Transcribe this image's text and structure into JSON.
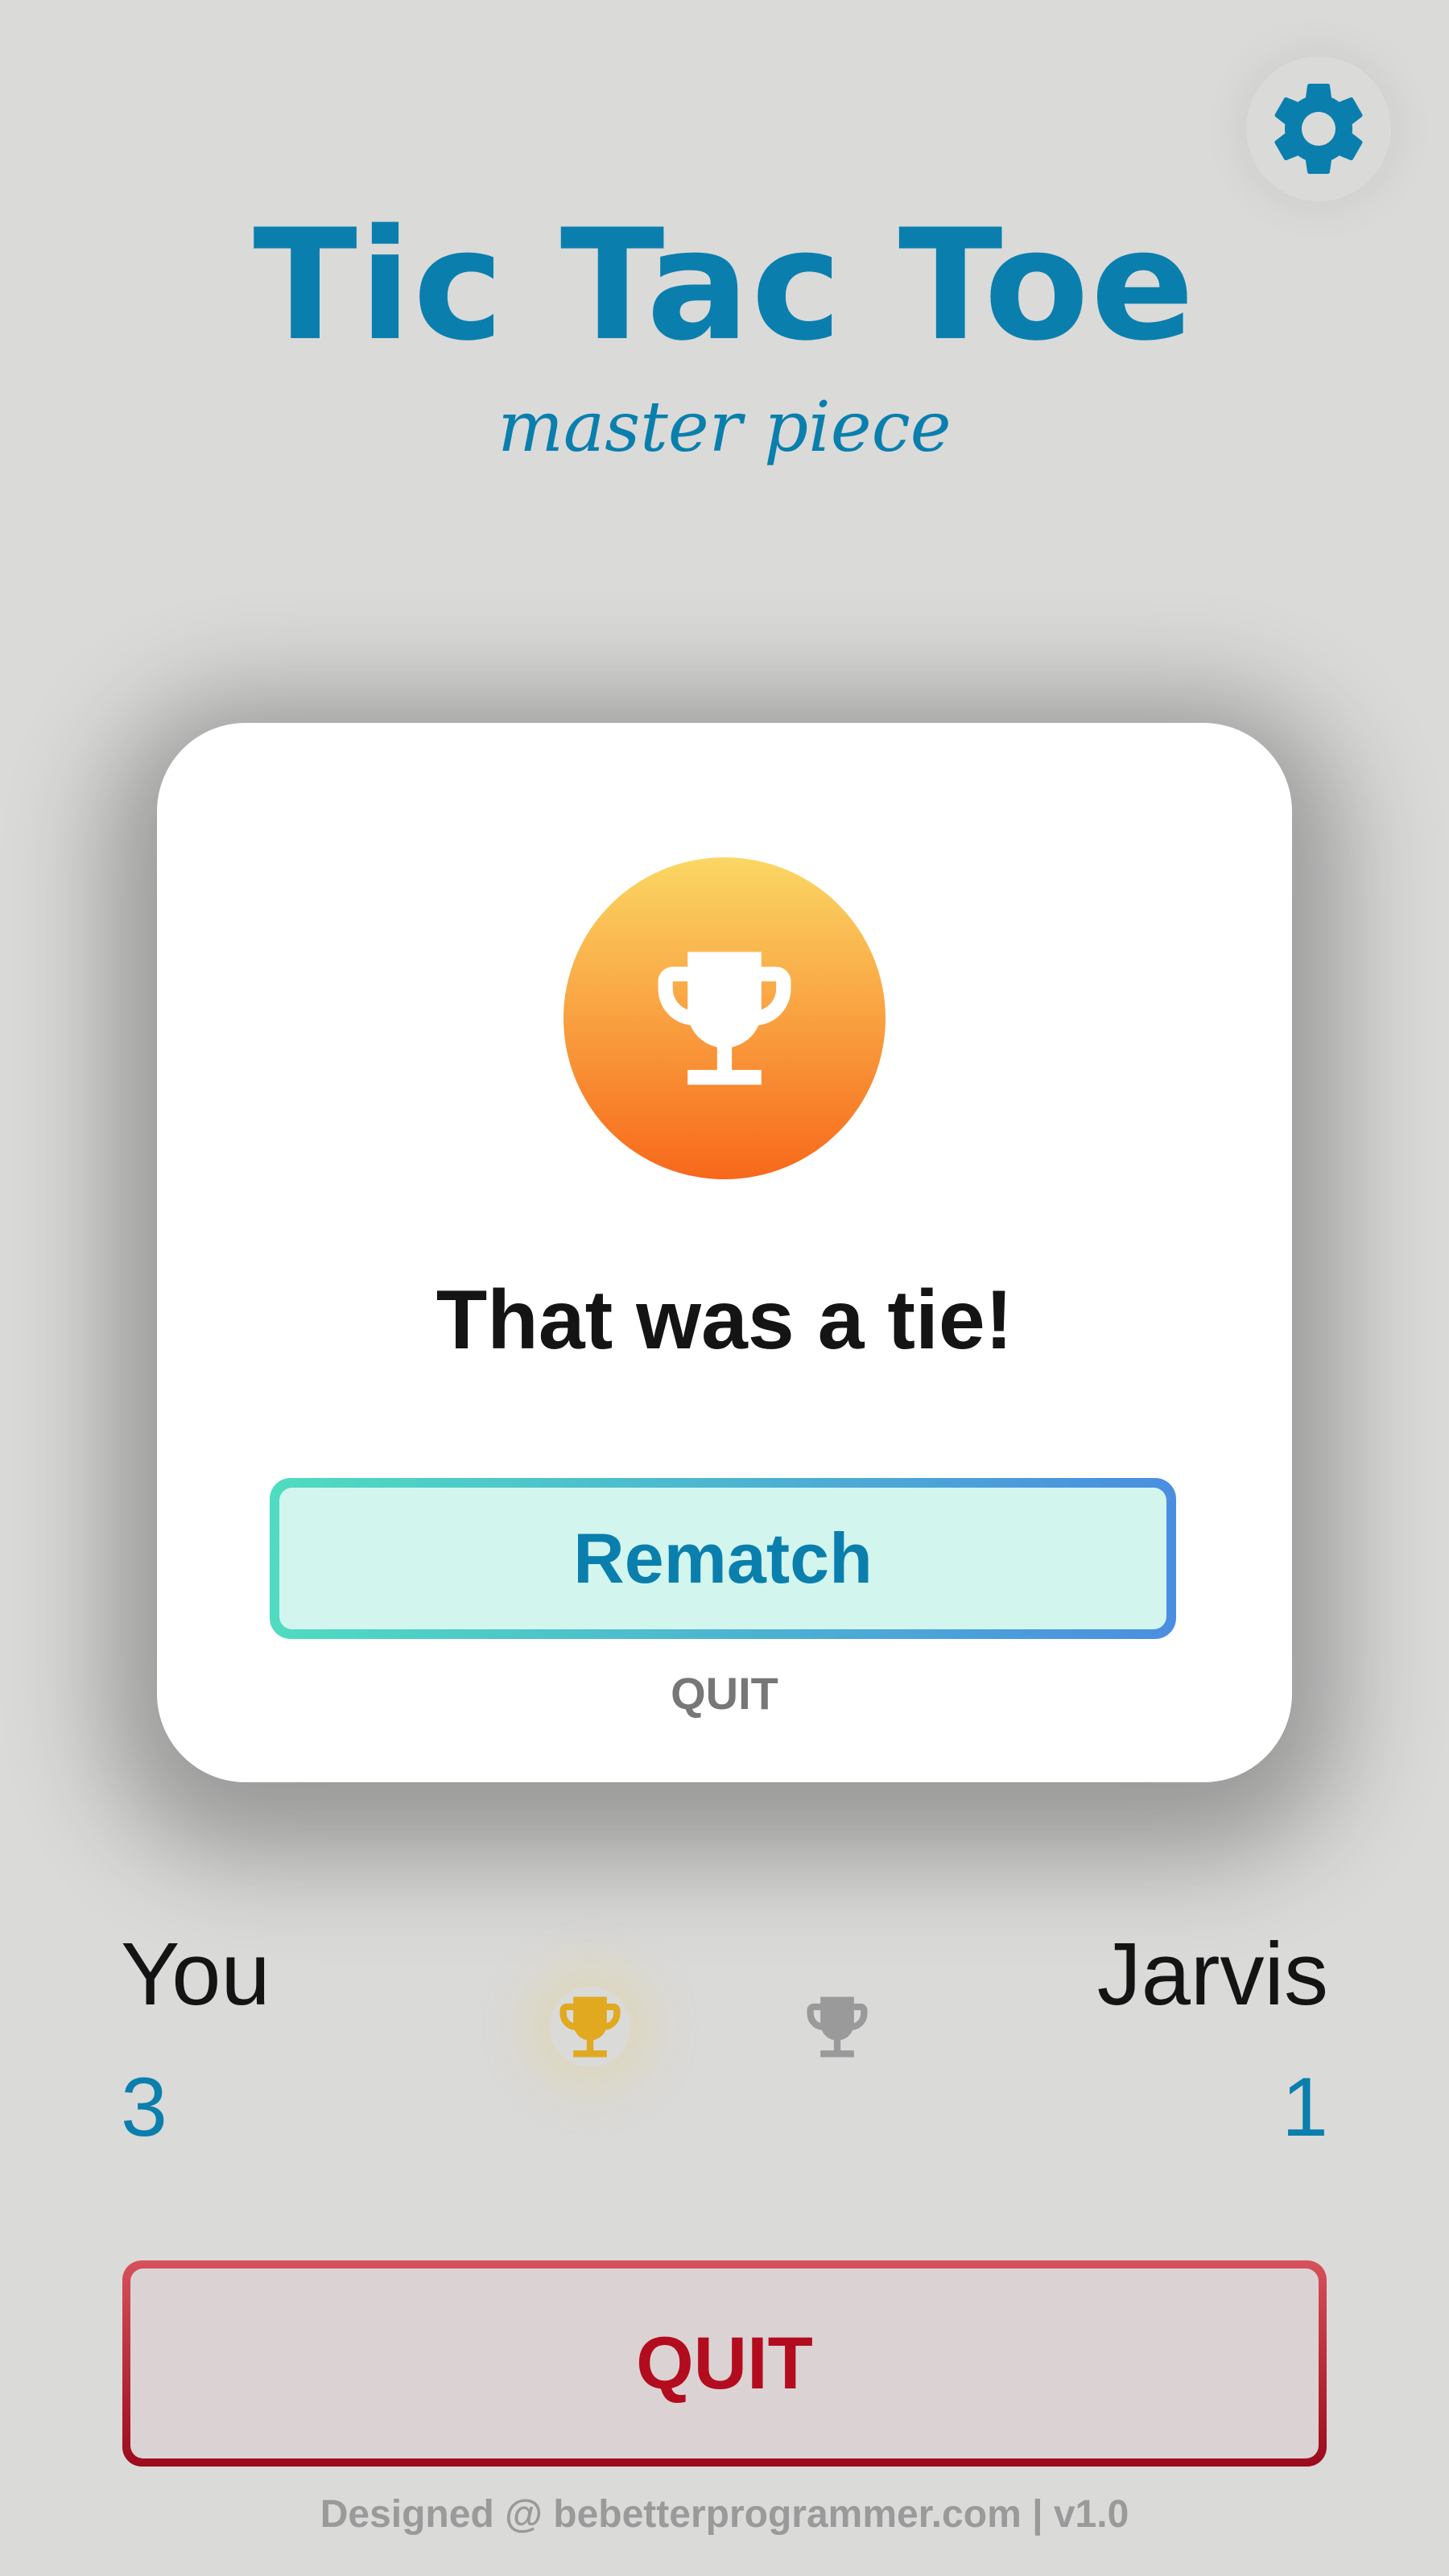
{
  "header": {
    "title": "Tic Tac Toe",
    "subtitle": "master piece",
    "settings_icon": "gear-icon"
  },
  "modal": {
    "icon": "trophy-icon",
    "result_text": "That was a tie!",
    "rematch_label": "Rematch",
    "quit_label": "QUIT"
  },
  "scoreboard": {
    "player1": {
      "name": "You",
      "score": "3"
    },
    "player2": {
      "name": "Jarvis",
      "score": "1"
    },
    "player1_trophy": "trophy-icon",
    "player2_trophy": "trophy-icon"
  },
  "actions": {
    "quit_label": "QUIT"
  },
  "footer": {
    "text": "Designed @ bebetterprogrammer.com | v1.0"
  },
  "colors": {
    "background": "#dadad9",
    "brand_blue": "#0a7fad",
    "quit_red": "#b30c1f",
    "trophy_gold": "#e0a91f",
    "trophy_gray": "#9a9a9a"
  }
}
